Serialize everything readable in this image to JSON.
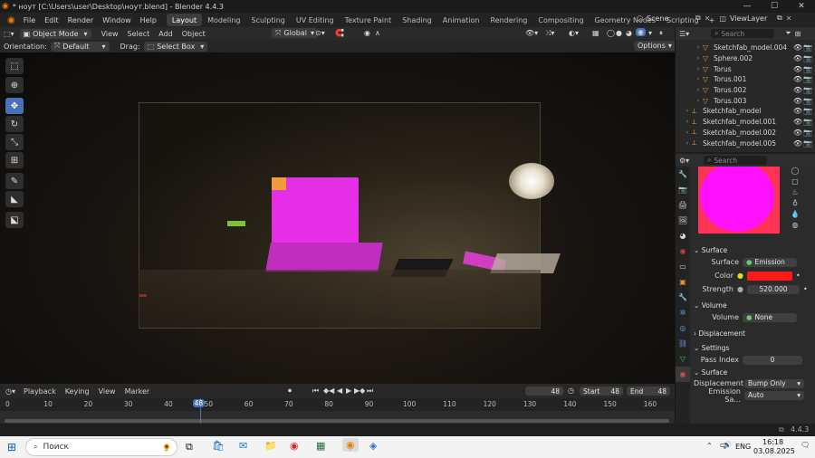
{
  "window": {
    "title": "* ноут [C:\\Users\\user\\Desktop\\ноут.blend] - Blender 4.4.3",
    "minimize": "—",
    "maximize": "☐",
    "close": "✕"
  },
  "menus": [
    "File",
    "Edit",
    "Render",
    "Window",
    "Help"
  ],
  "workspaces": [
    "Layout",
    "Modeling",
    "Sculpting",
    "UV Editing",
    "Texture Paint",
    "Shading",
    "Animation",
    "Rendering",
    "Compositing",
    "Geometry Nodes",
    "Scripting"
  ],
  "add_workspace": "+",
  "scene": "Scene",
  "view_layer": "ViewLayer",
  "header": {
    "mode": "Object Mode",
    "menus": [
      "View",
      "Select",
      "Add",
      "Object"
    ],
    "transform_orientation": "Global"
  },
  "tool_settings": {
    "orientation_label": "Orientation:",
    "orientation_value": "Default",
    "drag_label": "Drag:",
    "drag_value": "Select Box",
    "options": "Options"
  },
  "outliner": {
    "search_placeholder": "Search",
    "items": [
      {
        "name": "Sketchfab_model.004",
        "indent": 1
      },
      {
        "name": "Sphere.002",
        "indent": 1
      },
      {
        "name": "Torus",
        "indent": 1
      },
      {
        "name": "Torus.001",
        "indent": 1
      },
      {
        "name": "Torus.002",
        "indent": 1
      },
      {
        "name": "Torus.003",
        "indent": 1
      },
      {
        "name": "Sketchfab_model",
        "indent": 0
      },
      {
        "name": "Sketchfab_model.001",
        "indent": 0
      },
      {
        "name": "Sketchfab_model.002",
        "indent": 0
      },
      {
        "name": "Sketchfab_model.005",
        "indent": 0
      }
    ]
  },
  "properties": {
    "search_placeholder": "Search",
    "surface_section": "Surface",
    "surface_label": "Surface",
    "surface_value": "Emission",
    "color_label": "Color",
    "color_value": "#ff1a1a",
    "strength_label": "Strength",
    "strength_value": "520.000",
    "volume_section": "Volume",
    "volume_label": "Volume",
    "volume_value": "None",
    "displacement_section": "Displacement",
    "settings_section": "Settings",
    "pass_index_label": "Pass Index",
    "pass_index_value": "0",
    "surface_sub": "Surface",
    "displacement_label": "Displacement",
    "displacement_value": "Bump Only",
    "emission_sampling_label": "Emission Sa...",
    "emission_sampling_value": "Auto"
  },
  "timeline": {
    "menus": [
      "Playback",
      "Keying",
      "View",
      "Marker"
    ],
    "current_frame": "48",
    "start_label": "Start",
    "start_value": "48",
    "end_label": "End",
    "end_value": "48",
    "ticks": [
      "0",
      "10",
      "20",
      "30",
      "40",
      "50",
      "60",
      "70",
      "80",
      "90",
      "100",
      "110",
      "120",
      "130",
      "140",
      "150",
      "160"
    ],
    "playhead": "48"
  },
  "status": {
    "version": "4.4.3"
  },
  "taskbar": {
    "search_placeholder": "Поиск",
    "language": "ENG",
    "time": "16:18",
    "date": "03.08.2025"
  }
}
